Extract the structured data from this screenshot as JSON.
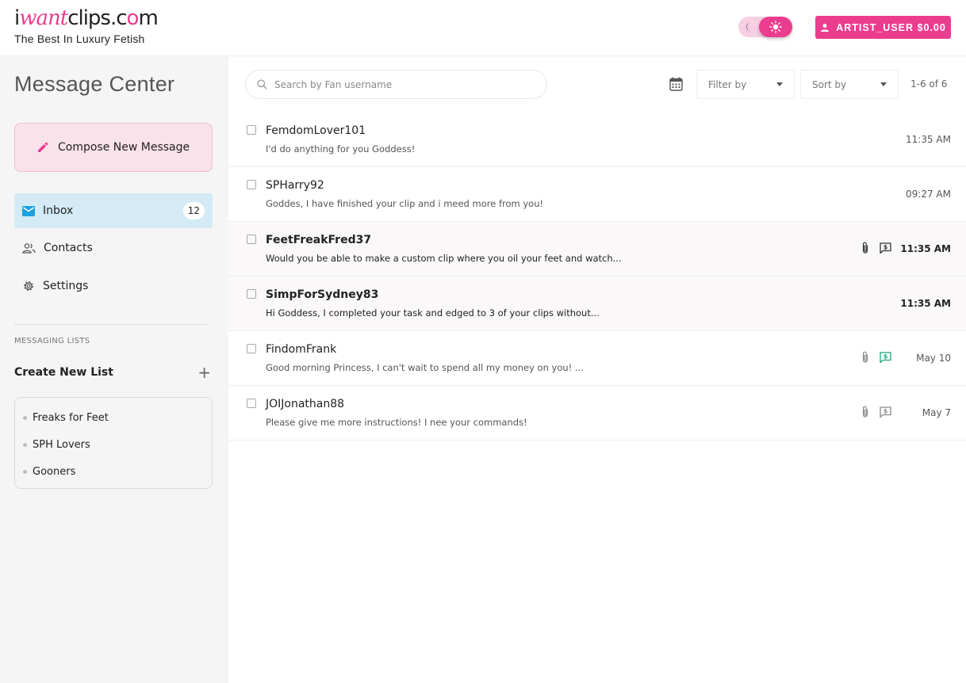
{
  "header": {
    "logo": {
      "part1": "i",
      "part2": "want",
      "part3": "clips.c",
      "part4": "o",
      "part5": "m"
    },
    "tagline": "The Best In Luxury Fetish",
    "user_button": "ARTIST_USER $0.00",
    "accent_color": "#ec3c8f"
  },
  "sidebar": {
    "title": "Message Center",
    "compose_label": "Compose New Message",
    "nav": [
      {
        "label": "Inbox",
        "icon": "mail-icon",
        "badge": "12",
        "active": true
      },
      {
        "label": "Contacts",
        "icon": "people-icon"
      },
      {
        "label": "Settings",
        "icon": "gear-icon"
      }
    ],
    "lists_heading": "MESSAGING LISTS",
    "create_list_label": "Create New List",
    "lists": [
      "Freaks for Feet",
      "SPH Lovers",
      "Gooners"
    ]
  },
  "toolbar": {
    "search_placeholder": "Search by Fan username",
    "filter_label": "Filter by",
    "sort_label": "Sort by",
    "page_count": "1-6 of 6"
  },
  "messages": [
    {
      "user": "FemdomLover101",
      "snippet": "I'd do anything for you Goddess!",
      "time": "11:35 AM",
      "unread": false,
      "attachment": false,
      "payment": "none"
    },
    {
      "user": "SPHarry92",
      "snippet": "Goddes, I have finished your clip and i meed more from you!",
      "time": "09:27 AM",
      "unread": false,
      "attachment": false,
      "payment": "none"
    },
    {
      "user": "FeetFreakFred37",
      "snippet": "Would you be able to make a custom clip where you oil your feet and watch...",
      "time": "11:35 AM",
      "unread": true,
      "attachment": true,
      "payment": "dark"
    },
    {
      "user": "SimpForSydney83",
      "snippet": "Hi Goddess, I completed your task and edged to 3 of your clips without...",
      "time": "11:35 AM",
      "unread": true,
      "attachment": false,
      "payment": "none"
    },
    {
      "user": "FindomFrank",
      "snippet": "Good morning Princess, I can't wait to spend all my money on you! ...",
      "time": "May 10",
      "unread": false,
      "attachment": true,
      "payment": "green"
    },
    {
      "user": "JOIJonathan88",
      "snippet": "Please give me more instructions! I nee your commands!",
      "time": "May 7",
      "unread": false,
      "attachment": true,
      "payment": "light"
    }
  ]
}
